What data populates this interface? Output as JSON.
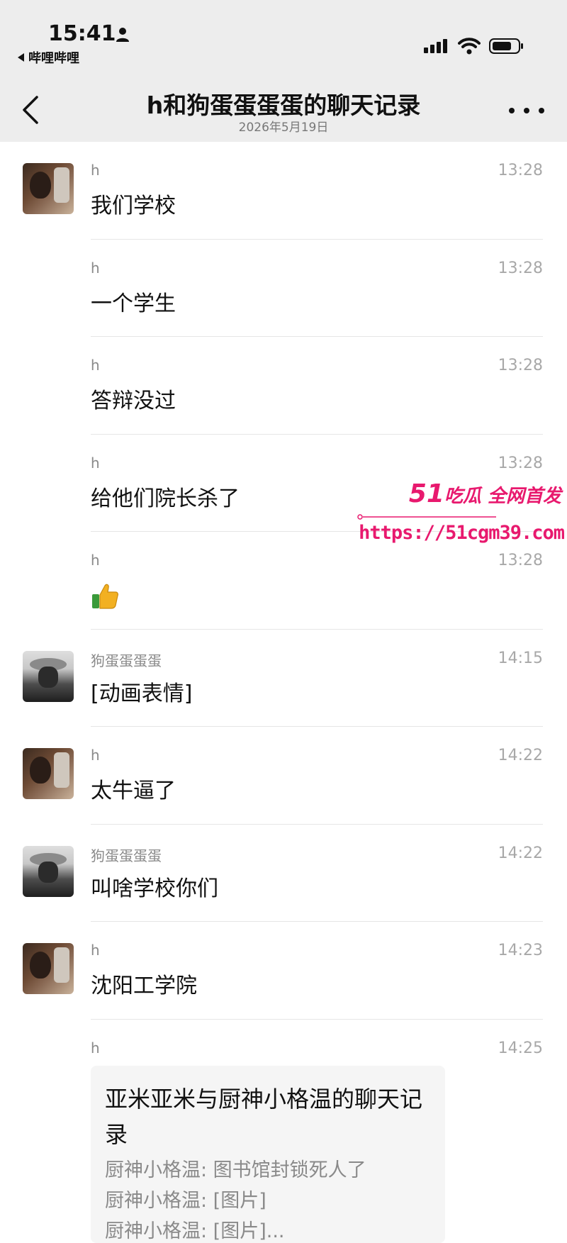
{
  "status_bar": {
    "time": "15:41",
    "back_app": "哔哩哔哩"
  },
  "nav": {
    "title": "h和狗蛋蛋蛋蛋的聊天记录",
    "subtitle": "2026年5月19日"
  },
  "messages": [
    {
      "sender": "h",
      "time": "13:28",
      "text": "我们学校",
      "avatar": "h"
    },
    {
      "sender": "h",
      "time": "13:28",
      "text": "一个学生",
      "avatar": ""
    },
    {
      "sender": "h",
      "time": "13:28",
      "text": "答辩没过",
      "avatar": ""
    },
    {
      "sender": "h",
      "time": "13:28",
      "text": "给他们院长杀了",
      "avatar": ""
    },
    {
      "sender": "h",
      "time": "13:28",
      "text": "",
      "avatar": "",
      "emoji": "thumbs-up-icon"
    },
    {
      "sender": "狗蛋蛋蛋蛋",
      "time": "14:15",
      "text": "[动画表情]",
      "avatar": "g"
    },
    {
      "sender": "h",
      "time": "14:22",
      "text": "太牛逼了",
      "avatar": "h"
    },
    {
      "sender": "狗蛋蛋蛋蛋",
      "time": "14:22",
      "text": "叫啥学校你们",
      "avatar": "g"
    },
    {
      "sender": "h",
      "time": "14:23",
      "text": "沈阳工学院",
      "avatar": "h"
    },
    {
      "sender": "h",
      "time": "14:25",
      "text": "",
      "avatar": ""
    }
  ],
  "chat_record_card": {
    "title": "亚米亚米与厨神小格温的聊天记录",
    "lines": [
      "厨神小格温: 图书馆封锁死人了",
      "厨神小格温: [图片]",
      "厨神小格温: [图片]..."
    ]
  },
  "watermark": {
    "brand_number": "51",
    "brand_text": "吃瓜 全网首发",
    "url": "https://51cgm39.com"
  },
  "colors": {
    "header_bg": "#ededed",
    "watermark": "#e8196e",
    "card_bg": "#f5f5f5"
  }
}
